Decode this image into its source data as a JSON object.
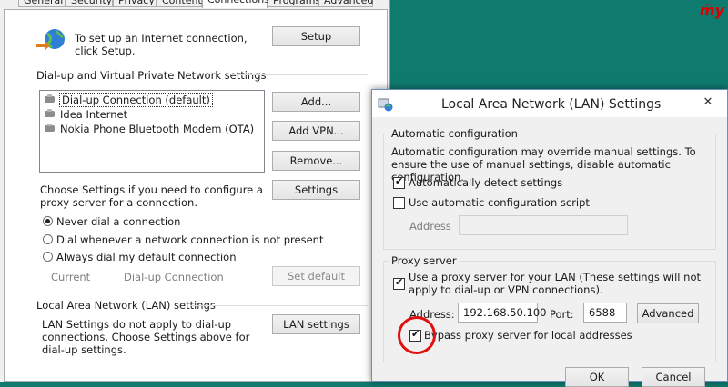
{
  "tabs": [
    "General",
    "Security",
    "Privacy",
    "Content",
    "Connections",
    "Programs",
    "Advanced"
  ],
  "setup": {
    "text": "To set up an Internet connection, click Setup.",
    "button": "Setup"
  },
  "dialup": {
    "heading": "Dial-up and Virtual Private Network settings",
    "items": [
      "Dial-up Connection (default)",
      "Idea Internet",
      "Nokia Phone Bluetooth Modem (OTA)"
    ],
    "add": "Add...",
    "add_vpn": "Add VPN...",
    "remove": "Remove...",
    "choose_text": "Choose Settings if you need to configure a proxy server for a connection.",
    "settings": "Settings",
    "radios": [
      "Never dial a connection",
      "Dial whenever a network connection is not present",
      "Always dial my default connection"
    ],
    "selected_radio": 0,
    "current_label": "Current",
    "current_value": "Dial-up Connection",
    "set_default": "Set default"
  },
  "lan_section": {
    "heading": "Local Area Network (LAN) settings",
    "text": "LAN Settings do not apply to dial-up connections. Choose Settings above for dial-up settings.",
    "button": "LAN settings"
  },
  "lan_dialog": {
    "title": "Local Area Network (LAN) Settings",
    "close": "✕",
    "auto": {
      "heading": "Automatic configuration",
      "description": "Automatic configuration may override manual settings.  To ensure the use of manual settings, disable automatic configuration.",
      "detect_label": "Automatically detect settings",
      "detect_checked": true,
      "script_label": "Use automatic configuration script",
      "script_checked": false,
      "address_label": "Address",
      "address_value": ""
    },
    "proxy": {
      "heading": "Proxy server",
      "use_label": "Use a proxy server for your LAN (These settings will not apply to dial-up or VPN connections).",
      "use_checked": true,
      "address_label": "Address:",
      "address_value": "192.168.50.100",
      "port_label": "Port:",
      "port_value": "6588",
      "advanced": "Advanced",
      "bypass_label": "Bypass proxy server for local addresses",
      "bypass_checked": true
    },
    "ok": "OK",
    "cancel": "Cancel"
  },
  "colors": {
    "desktop": "#0f7a6e",
    "annotation": "#e01010"
  }
}
